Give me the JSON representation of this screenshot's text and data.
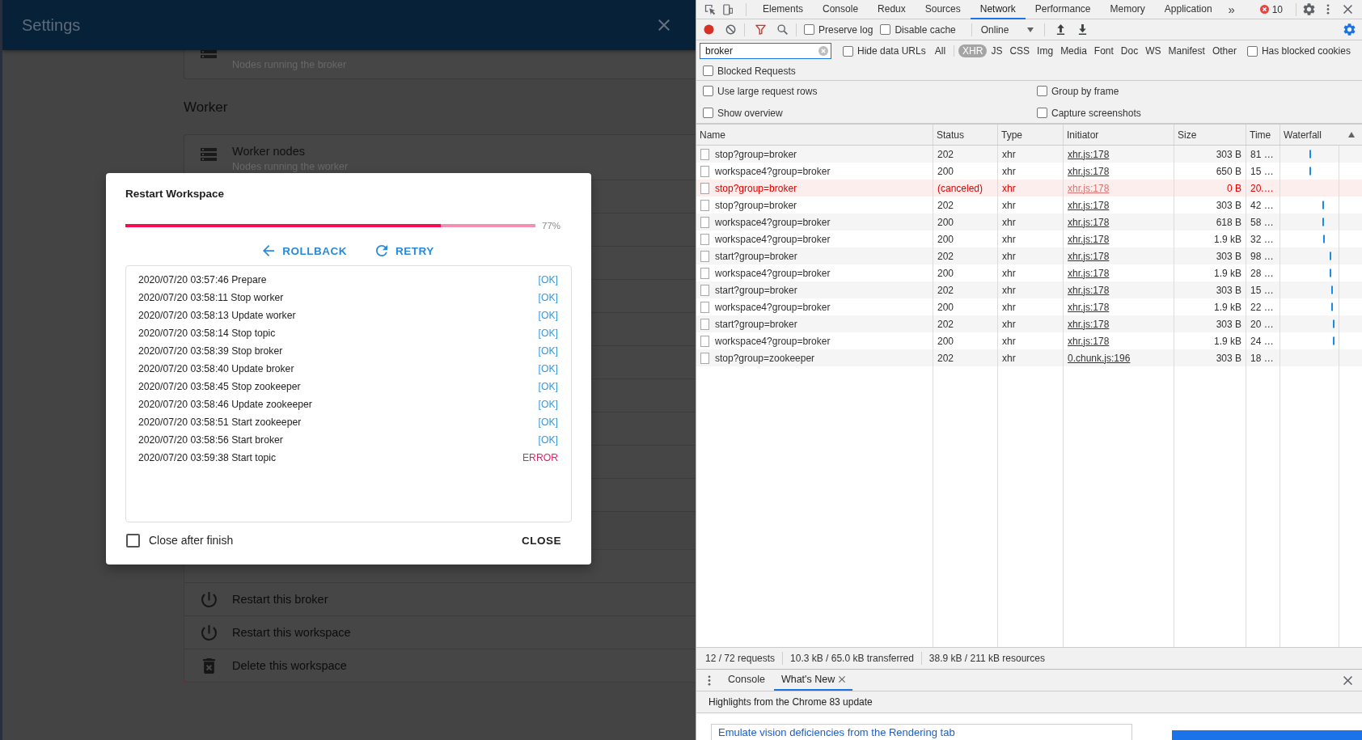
{
  "app": {
    "title": "Settings"
  },
  "broker_card": {
    "subtitle": "Nodes running the broker"
  },
  "worker_section": {
    "heading": "Worker",
    "card": {
      "title": "Worker nodes",
      "subtitle": "Nodes running the worker"
    }
  },
  "danger_actions": [
    {
      "kind": "restart",
      "label": "Restart this broker"
    },
    {
      "kind": "restart",
      "label": "Restart this workspace"
    },
    {
      "kind": "delete",
      "label": "Delete this workspace"
    }
  ],
  "dialog": {
    "title": "Restart Workspace",
    "progress": {
      "level": 0.77,
      "reading": "77%"
    },
    "actions": [
      {
        "kind": "rollback",
        "label": "ROLLBACK"
      },
      {
        "kind": "retry",
        "label": "RETRY"
      }
    ],
    "log": [
      {
        "text": "2020/07/20 03:57:46 Prepare",
        "status": "[OK]",
        "kind": "ok"
      },
      {
        "text": "2020/07/20 03:58:11 Stop worker",
        "status": "[OK]",
        "kind": "ok"
      },
      {
        "text": "2020/07/20 03:58:13 Update worker",
        "status": "[OK]",
        "kind": "ok"
      },
      {
        "text": "2020/07/20 03:58:14 Stop topic",
        "status": "[OK]",
        "kind": "ok"
      },
      {
        "text": "2020/07/20 03:58:39 Stop broker",
        "status": "[OK]",
        "kind": "ok"
      },
      {
        "text": "2020/07/20 03:58:40 Update broker",
        "status": "[OK]",
        "kind": "ok"
      },
      {
        "text": "2020/07/20 03:58:45 Stop zookeeper",
        "status": "[OK]",
        "kind": "ok"
      },
      {
        "text": "2020/07/20 03:58:46 Update zookeeper",
        "status": "[OK]",
        "kind": "ok"
      },
      {
        "text": "2020/07/20 03:58:51 Start zookeeper",
        "status": "[OK]",
        "kind": "ok"
      },
      {
        "text": "2020/07/20 03:58:56 Start broker",
        "status": "[OK]",
        "kind": "ok"
      },
      {
        "text": "2020/07/20 03:59:38 Start topic",
        "status": "ERROR",
        "kind": "error"
      }
    ],
    "close_after_finish": {
      "label": "Close after finish",
      "checked": false
    },
    "close_button": "CLOSE"
  },
  "devtools": {
    "tabs": [
      {
        "label": "Elements",
        "selected": false
      },
      {
        "label": "Console",
        "selected": false
      },
      {
        "label": "Redux",
        "selected": false
      },
      {
        "label": "Sources",
        "selected": false
      },
      {
        "label": "Network",
        "selected": true
      },
      {
        "label": "Performance",
        "selected": false
      },
      {
        "label": "Memory",
        "selected": false
      },
      {
        "label": "Application",
        "selected": false
      }
    ],
    "more_tabs": "»",
    "error_count": "10",
    "toolbar": {
      "recording": true,
      "preserve_log": {
        "label": "Preserve log",
        "checked": false
      },
      "disable_cache": {
        "label": "Disable cache",
        "checked": false
      },
      "throttling": "Online"
    },
    "filter": {
      "value": "broker",
      "hide_data_urls": {
        "label": "Hide data URLs",
        "checked": false
      },
      "types": [
        {
          "label": "All",
          "selected": false
        },
        {
          "label": "XHR",
          "selected": true
        },
        {
          "label": "JS",
          "selected": false
        },
        {
          "label": "CSS",
          "selected": false
        },
        {
          "label": "Img",
          "selected": false
        },
        {
          "label": "Media",
          "selected": false
        },
        {
          "label": "Font",
          "selected": false
        },
        {
          "label": "Doc",
          "selected": false
        },
        {
          "label": "WS",
          "selected": false
        },
        {
          "label": "Manifest",
          "selected": false
        },
        {
          "label": "Other",
          "selected": false
        }
      ],
      "has_blocked_cookies": {
        "label": "Has blocked cookies",
        "checked": false
      },
      "blocked_requests": {
        "label": "Blocked Requests",
        "checked": false
      }
    },
    "settings": [
      {
        "label": "Use large request rows",
        "checked": false
      },
      {
        "label": "Group by frame",
        "checked": false
      },
      {
        "label": "Show overview",
        "checked": false
      },
      {
        "label": "Capture screenshots",
        "checked": false
      }
    ],
    "table": {
      "columns": [
        {
          "label": "Name",
          "sorted": false
        },
        {
          "label": "Status",
          "sorted": false
        },
        {
          "label": "Type",
          "sorted": false
        },
        {
          "label": "Initiator",
          "sorted": false
        },
        {
          "label": "Size",
          "sorted": false
        },
        {
          "label": "Time",
          "sorted": false
        },
        {
          "label": "Waterfall",
          "sorted": true
        }
      ],
      "rows": [
        {
          "name": "stop?group=broker",
          "status": "202",
          "type": "xhr",
          "initiator": "xhr.js:178",
          "size": "303 B",
          "time": "81 …",
          "canceled": false
        },
        {
          "name": "workspace4?group=broker",
          "status": "200",
          "type": "xhr",
          "initiator": "xhr.js:178",
          "size": "650 B",
          "time": "15 …",
          "canceled": false
        },
        {
          "name": "stop?group=broker",
          "status": "(canceled)",
          "type": "xhr",
          "initiator": "xhr.js:178",
          "size": "0 B",
          "time": "20.…",
          "canceled": true
        },
        {
          "name": "stop?group=broker",
          "status": "202",
          "type": "xhr",
          "initiator": "xhr.js:178",
          "size": "303 B",
          "time": "42 …",
          "canceled": false
        },
        {
          "name": "workspace4?group=broker",
          "status": "200",
          "type": "xhr",
          "initiator": "xhr.js:178",
          "size": "618 B",
          "time": "58 …",
          "canceled": false
        },
        {
          "name": "workspace4?group=broker",
          "status": "200",
          "type": "xhr",
          "initiator": "xhr.js:178",
          "size": "1.9 kB",
          "time": "32 …",
          "canceled": false
        },
        {
          "name": "start?group=broker",
          "status": "202",
          "type": "xhr",
          "initiator": "xhr.js:178",
          "size": "303 B",
          "time": "98 …",
          "canceled": false
        },
        {
          "name": "workspace4?group=broker",
          "status": "200",
          "type": "xhr",
          "initiator": "xhr.js:178",
          "size": "1.9 kB",
          "time": "28 …",
          "canceled": false
        },
        {
          "name": "start?group=broker",
          "status": "202",
          "type": "xhr",
          "initiator": "xhr.js:178",
          "size": "303 B",
          "time": "15 …",
          "canceled": false
        },
        {
          "name": "workspace4?group=broker",
          "status": "200",
          "type": "xhr",
          "initiator": "xhr.js:178",
          "size": "1.9 kB",
          "time": "22 …",
          "canceled": false
        },
        {
          "name": "start?group=broker",
          "status": "202",
          "type": "xhr",
          "initiator": "xhr.js:178",
          "size": "303 B",
          "time": "20 …",
          "canceled": false
        },
        {
          "name": "workspace4?group=broker",
          "status": "200",
          "type": "xhr",
          "initiator": "xhr.js:178",
          "size": "1.9 kB",
          "time": "24 …",
          "canceled": false
        },
        {
          "name": "stop?group=zookeeper",
          "status": "202",
          "type": "xhr",
          "initiator": "0.chunk.js:196",
          "size": "303 B",
          "time": "18 …",
          "canceled": false
        }
      ]
    },
    "status_bar": [
      "12 / 72 requests",
      "10.3 kB / 65.0 kB transferred",
      "38.9 kB / 211 kB resources"
    ],
    "drawer": {
      "tabs": [
        {
          "label": "Console",
          "selected": false,
          "closable": false
        },
        {
          "label": "What's New",
          "selected": true,
          "closable": true
        }
      ],
      "heading": "Highlights from the Chrome 83 update",
      "article_link": "Emulate vision deficiencies from the Rendering tab"
    }
  }
}
